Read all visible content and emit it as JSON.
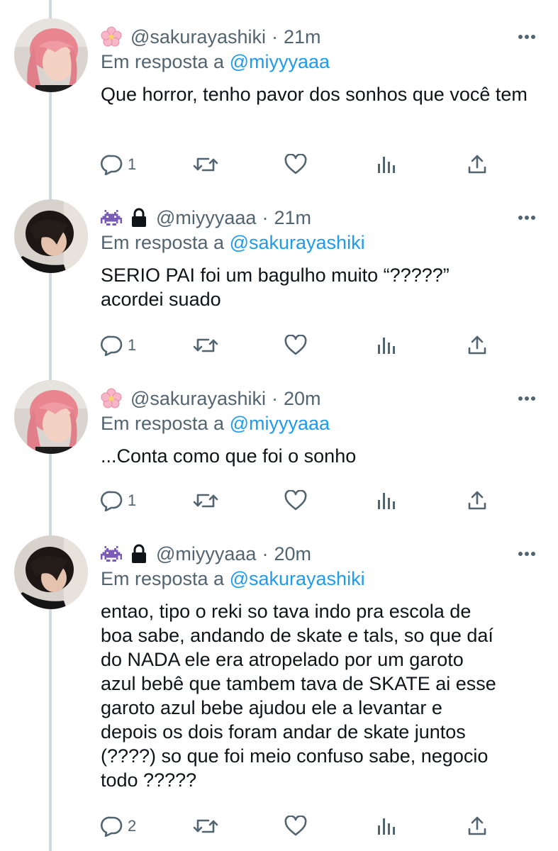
{
  "thread": [
    {
      "avatar": "avatar-pink-hair",
      "emoji": "cherry-blossom-emoji",
      "lock": false,
      "handle": "@sakurayashiki",
      "dot": "·",
      "time": "21m",
      "reply_prefix": "Em resposta a",
      "reply_to": "@miyyyaaa",
      "text": "Que horror, tenho pavor dos sonhos que você tem",
      "reply_count": "1",
      "retweet_count": "",
      "like_count": ""
    },
    {
      "avatar": "avatar-dark-hair",
      "emoji": "space-invader-emoji",
      "lock": true,
      "handle": "@miyyyaaa",
      "dot": "·",
      "time": "21m",
      "reply_prefix": "Em resposta a",
      "reply_to": "@sakurayashiki",
      "text": "SERIO PAI foi um bagulho muito “?????”\nacordei suado",
      "reply_count": "1",
      "retweet_count": "",
      "like_count": ""
    },
    {
      "avatar": "avatar-pink-hair",
      "emoji": "cherry-blossom-emoji",
      "lock": false,
      "handle": "@sakurayashiki",
      "dot": "·",
      "time": "20m",
      "reply_prefix": "Em resposta a",
      "reply_to": "@miyyyaaa",
      "text": "...Conta como que foi o sonho",
      "reply_count": "1",
      "retweet_count": "",
      "like_count": ""
    },
    {
      "avatar": "avatar-dark-hair",
      "emoji": "space-invader-emoji",
      "lock": true,
      "handle": "@miyyyaaa",
      "dot": "·",
      "time": "20m",
      "reply_prefix": "Em resposta a",
      "reply_to": "@sakurayashiki",
      "text": "entao, tipo o reki so tava indo pra escola de\nboa sabe, andando de skate e tals, so que daí\ndo NADA ele era atropelado por um garoto\nazul bebê que tambem tava de SKATE ai esse\ngaroto azul bebe ajudou ele a levantar e\ndepois os dois foram andar de skate juntos\n(????) so que foi meio confuso sabe, negocio\ntodo ?????",
      "reply_count": "2",
      "retweet_count": "",
      "like_count": ""
    }
  ],
  "colors": {
    "text": "#0f1419",
    "secondary": "#536471",
    "link": "#1d9bf0",
    "thread_line": "#cfd9de"
  }
}
